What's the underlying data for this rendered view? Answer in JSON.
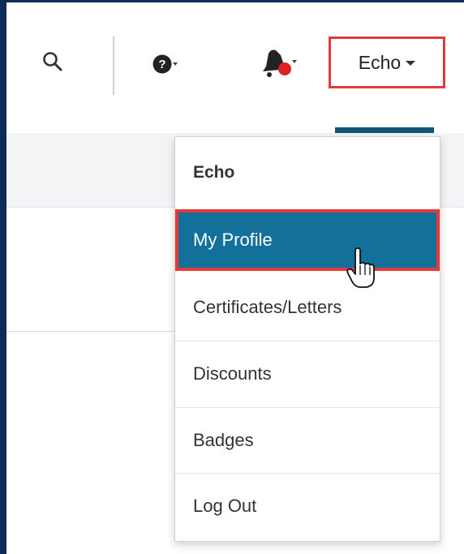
{
  "topbar": {
    "icons": {
      "search": "search-icon",
      "help": "help-icon",
      "notifications": "bell-icon"
    },
    "user_button": {
      "label": "Echo",
      "highlight_color": "#e33b3b"
    }
  },
  "dropdown": {
    "header": "Echo",
    "items": [
      {
        "label": "My Profile",
        "active": true
      },
      {
        "label": "Certificates/Letters",
        "active": false
      },
      {
        "label": "Discounts",
        "active": false
      },
      {
        "label": "Badges",
        "active": false
      },
      {
        "label": "Log Out",
        "active": false
      }
    ],
    "active_color": "#12709a"
  },
  "colors": {
    "frame_border": "#0d2b57",
    "active_tab_indicator": "#115577",
    "notification_dot": "#e02020"
  }
}
